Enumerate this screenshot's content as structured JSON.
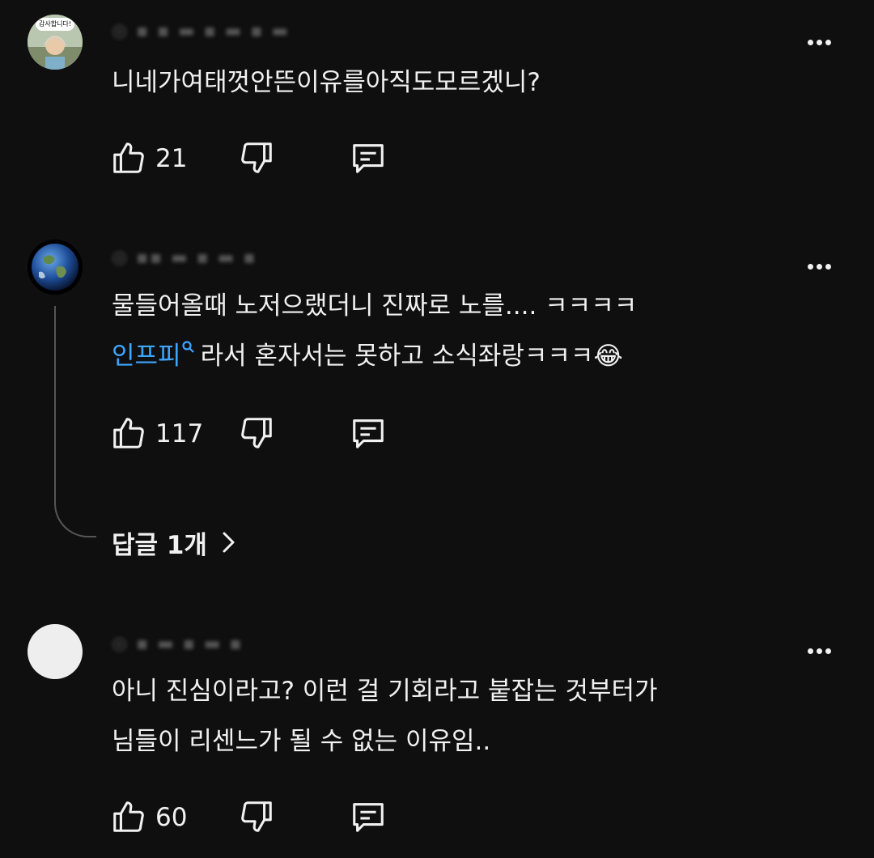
{
  "comments": [
    {
      "avatar_badge": "감사합니다!",
      "text_lines": [
        "니네가여태껏안뜬이유를아직도모르겠니?"
      ],
      "like_count": "21",
      "icons": {
        "like": "thumb-up-icon",
        "dislike": "thumb-down-icon",
        "reply": "reply-comment-icon",
        "more": "more-vert-icon"
      }
    },
    {
      "text_lines": [
        "물들어올때 노저으랬더니 진짜로 노를.... ㅋㅋㅋㅋ"
      ],
      "link_text": "인프피",
      "text_after_link": "라서 혼자서는 못하고 소식좌랑ㅋㅋㅋ😂",
      "like_count": "117",
      "replies_label": "답글 1개"
    },
    {
      "text_lines": [
        "아니 진심이라고? 이런 걸 기회라고 붙잡는 것부터가",
        "님들이 리센느가 될 수 없는 이유임.."
      ],
      "like_count": "60"
    }
  ],
  "colors": {
    "background": "#0f0f0f",
    "text": "#f1f1f1",
    "link": "#3ea6ff",
    "thread_line": "#555555"
  }
}
